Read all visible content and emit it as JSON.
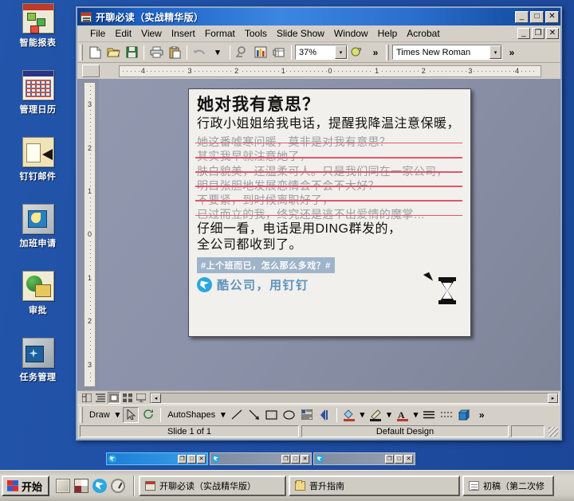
{
  "desktop": {
    "icons": [
      {
        "label": "智能报表",
        "icon": "report-chart-icon"
      },
      {
        "label": "管理日历",
        "icon": "calendar-icon"
      },
      {
        "label": "钉钉邮件",
        "icon": "mail-folder-icon"
      },
      {
        "label": "加班申请",
        "icon": "overtime-monitor-icon"
      },
      {
        "label": "审批",
        "icon": "approval-globe-icon"
      },
      {
        "label": "任务管理",
        "icon": "task-monitor-icon"
      }
    ]
  },
  "window": {
    "title": "开聊必读（实战精华版）",
    "app_icon": "powerpoint-icon",
    "controls": {
      "minimize": "_",
      "maximize": "□",
      "close": "✕",
      "restore": "❐"
    },
    "menus": [
      {
        "label": "File"
      },
      {
        "label": "Edit"
      },
      {
        "label": "View"
      },
      {
        "label": "Insert"
      },
      {
        "label": "Format"
      },
      {
        "label": "Tools"
      },
      {
        "label": "Slide Show"
      },
      {
        "label": "Window"
      },
      {
        "label": "Help"
      },
      {
        "label": "Acrobat"
      }
    ],
    "toolbar": {
      "buttons": [
        {
          "name": "new-icon"
        },
        {
          "name": "open-icon"
        },
        {
          "name": "save-icon"
        },
        {
          "name": "print-icon"
        },
        {
          "name": "paste-icon"
        },
        {
          "name": "undo-icon"
        },
        {
          "name": "hyperlink-icon"
        },
        {
          "name": "chart-icon"
        },
        {
          "name": "table-icon"
        }
      ],
      "zoom_value": "37%",
      "font_value": "Times New Roman",
      "overflow_label": "»"
    },
    "rulers": {
      "horizontal": [
        "4",
        "3",
        "2",
        "1",
        "0",
        "1",
        "2",
        "3",
        "4"
      ],
      "vertical": [
        "3",
        "2",
        "1",
        "0",
        "1",
        "2",
        "3"
      ]
    },
    "slide": {
      "title": "她对我有意思？",
      "lead": "行政小姐姐给我电话，提醒我降温注意保暖，",
      "struck_lines": [
        "她这番嘘寒问暖，莫非是对我有意思？",
        "其实我早就注意她了，",
        "肤白貌美，还温柔可人。只是我们同在一家公司，",
        "明目张胆地发展恋情会不会不大好？",
        "不要紧，到时候离职好了，",
        "已过而立的我，终究还是逃不出爱情的魔掌…"
      ],
      "final_lines": [
        "仔细一看，电话是用DING群发的，",
        "全公司都收到了。"
      ],
      "hashtag": "#上个班而已，怎么那么多戏？#",
      "brand_text": "酷公司，用钉钉",
      "brand_logo": "dingtalk-logo",
      "cursor": "arrow-hourglass-cursor"
    },
    "viewbar": {
      "buttons": [
        {
          "name": "normal-view-button"
        },
        {
          "name": "outline-view-button"
        },
        {
          "name": "slide-view-button"
        },
        {
          "name": "slide-sorter-view-button"
        },
        {
          "name": "slide-show-button"
        }
      ]
    },
    "drawbar": {
      "draw_label": "Draw",
      "autoshapes_label": "AutoShapes",
      "buttons": [
        {
          "name": "select-arrow-icon"
        },
        {
          "name": "rotate-icon"
        },
        {
          "name": "line-icon"
        },
        {
          "name": "arrow-icon"
        },
        {
          "name": "rectangle-icon"
        },
        {
          "name": "oval-icon"
        },
        {
          "name": "text-box-icon"
        },
        {
          "name": "word-art-icon"
        },
        {
          "name": "fill-color-icon"
        },
        {
          "name": "line-color-icon"
        },
        {
          "name": "font-color-icon"
        },
        {
          "name": "line-style-icon"
        },
        {
          "name": "dash-style-icon"
        },
        {
          "name": "3d-style-icon"
        }
      ],
      "overflow_label": "»"
    },
    "status": {
      "slide_indicator": "Slide 1 of 1",
      "design_name": "Default Design",
      "extra": ""
    }
  },
  "minimized_windows": [
    {
      "title": "",
      "active": true
    },
    {
      "title": "",
      "active": false
    },
    {
      "title": "",
      "active": false
    }
  ],
  "taskbar": {
    "start_label": "开始",
    "quick_launch": [
      {
        "name": "show-desktop-icon"
      },
      {
        "name": "ie-browser-icon"
      },
      {
        "name": "dingtalk-icon"
      },
      {
        "name": "clock-icon"
      }
    ],
    "buttons": [
      {
        "label": "开聊必读（实战精华版）",
        "icon": "powerpoint-icon"
      },
      {
        "label": "晋升指南",
        "icon": "folder-icon"
      },
      {
        "label": "初稿（第二次修",
        "icon": "document-icon"
      }
    ]
  },
  "colors": {
    "desktop_blue": "#1f4fa4",
    "titlebar_blue": "#1b5fc4",
    "chrome_gray": "#d4d0c8",
    "strike_red": "#e4556a",
    "dingtalk_blue": "#2ba7e0",
    "hashtag_bg": "#9fb4c9"
  }
}
